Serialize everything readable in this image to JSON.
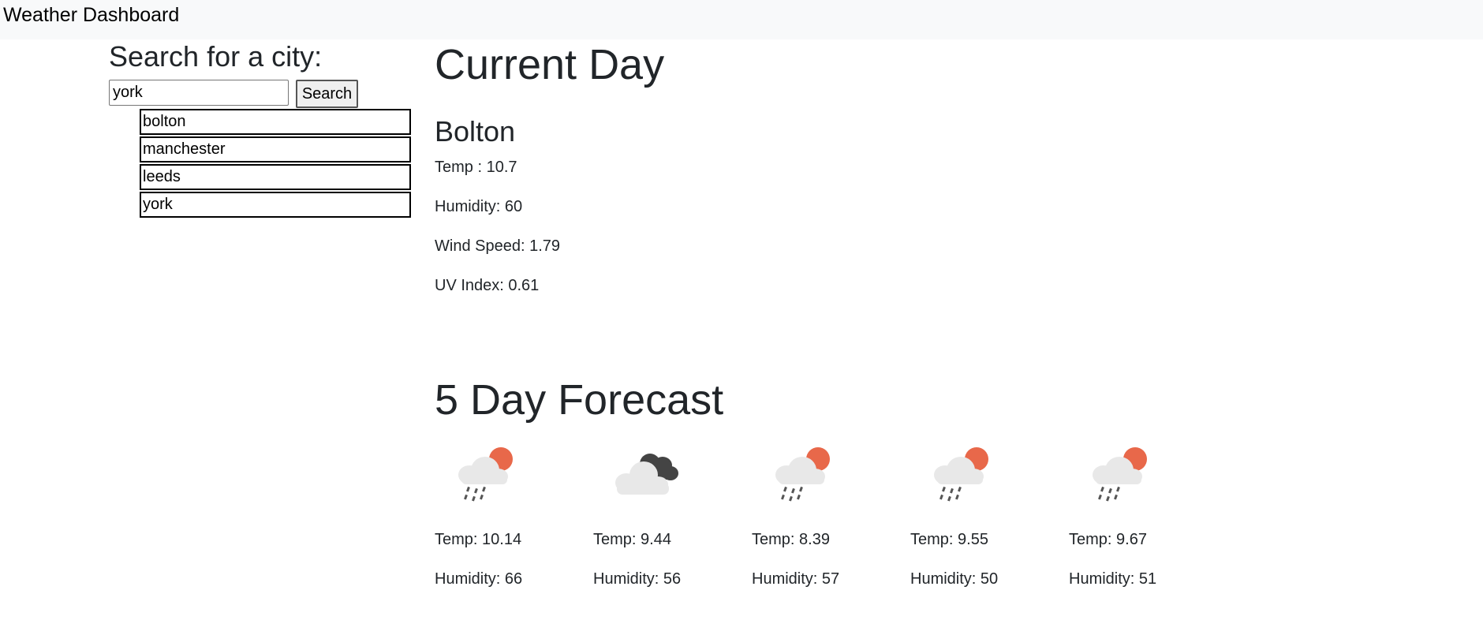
{
  "navbar": {
    "brand": "Weather Dashboard"
  },
  "search": {
    "title": "Search for a city:",
    "input_value": "york",
    "button_label": "Search",
    "history": [
      "bolton",
      "manchester",
      "leeds",
      "york"
    ]
  },
  "current": {
    "heading": "Current Day",
    "city": "Bolton",
    "temp": "Temp : 10.7",
    "humidity": "Humidity: 60",
    "wind": "Wind Speed: 1.79",
    "uv": "UV Index: 0.61"
  },
  "forecast": {
    "heading": "5 Day Forecast",
    "days": [
      {
        "icon": "rain-sun-icon",
        "temp": "Temp: 10.14",
        "humidity": "Humidity: 66"
      },
      {
        "icon": "cloudy-icon",
        "temp": "Temp: 9.44",
        "humidity": "Humidity: 56"
      },
      {
        "icon": "rain-sun-icon",
        "temp": "Temp: 8.39",
        "humidity": "Humidity: 57"
      },
      {
        "icon": "rain-sun-icon",
        "temp": "Temp: 9.55",
        "humidity": "Humidity: 50"
      },
      {
        "icon": "rain-sun-icon",
        "temp": "Temp: 9.67",
        "humidity": "Humidity: 51"
      }
    ]
  },
  "colors": {
    "navbar_bg": "#f8f9fa",
    "sun": "#e8684a",
    "cloud_light": "#e8e8e8",
    "cloud_dark": "#444444",
    "rain": "#555555"
  }
}
